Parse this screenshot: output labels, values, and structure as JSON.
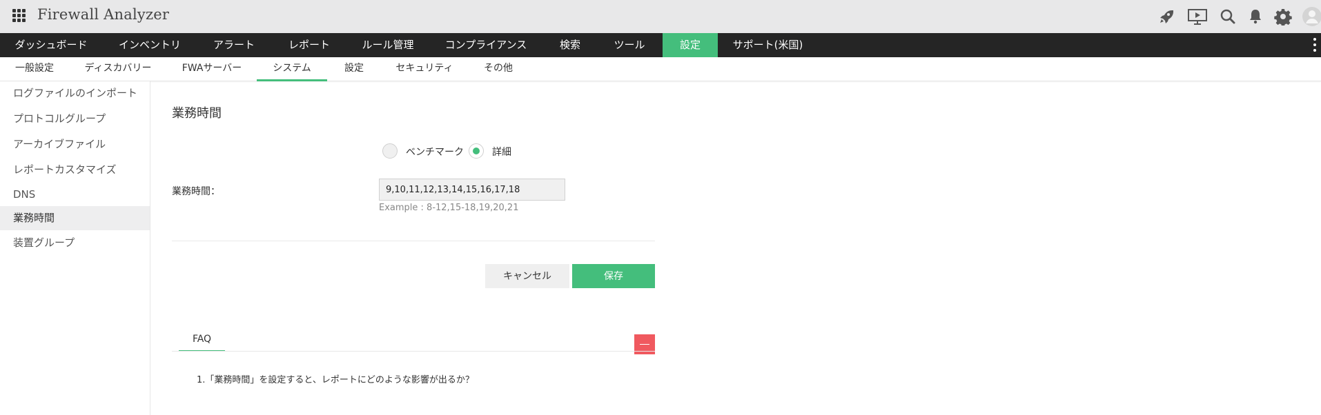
{
  "app": {
    "title": "Firewall Analyzer"
  },
  "top_icons": [
    "rocket-icon",
    "presentation-icon",
    "search-icon",
    "bell-icon",
    "gear-icon",
    "user-avatar-icon"
  ],
  "main_nav": {
    "items": [
      "ダッシュボード",
      "インベントリ",
      "アラート",
      "レポート",
      "ルール管理",
      "コンプライアンス",
      "検索",
      "ツール",
      "設定",
      "サポート(米国)"
    ],
    "active": "設定"
  },
  "sub_nav": {
    "items": [
      "一般設定",
      "ディスカバリー",
      "FWAサーバー",
      "システム",
      "設定",
      "セキュリティ",
      "その他"
    ],
    "active": "システム"
  },
  "sidebar": {
    "items": [
      "ログファイルのインポート",
      "プロトコルグループ",
      "アーカイブファイル",
      "レポートカスタマイズ",
      "DNS",
      "業務時間",
      "装置グループ"
    ],
    "active": "業務時間"
  },
  "page": {
    "title": "業務時間",
    "radio": {
      "benchmark_label": "ベンチマーク",
      "detail_label": "詳細",
      "selected": "詳細"
    },
    "hours": {
      "label": "業務時間：",
      "value": "9,10,11,12,13,14,15,16,17,18",
      "example": "Example : 8-12,15-18,19,20,21"
    },
    "buttons": {
      "cancel": "キャンセル",
      "save": "保存"
    },
    "faq": {
      "tab_label": "FAQ",
      "items": [
        "1.「業務時間」を設定すると、レポートにどのような影響が出るか？"
      ]
    }
  },
  "colors": {
    "accent": "#44be7c",
    "nav_bg": "#252525",
    "topbar_bg": "#e8e8e9",
    "collapse_red": "#f0595f"
  }
}
